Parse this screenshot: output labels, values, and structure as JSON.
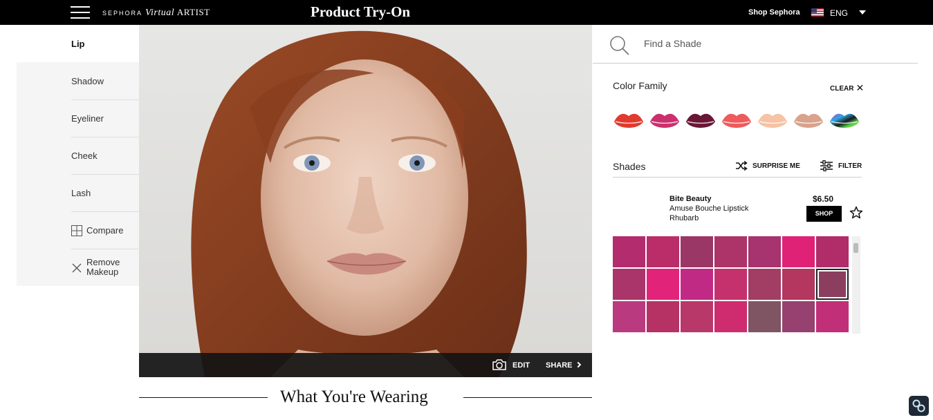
{
  "header": {
    "brand_sephora": "SEPHORA",
    "brand_virtual": "Virtual",
    "brand_artist": "ARTIST",
    "title": "Product Try-On",
    "shop_link": "Shop Sephora",
    "language": "ENG"
  },
  "sidebar": {
    "items": [
      {
        "label": "Lip"
      },
      {
        "label": "Shadow"
      },
      {
        "label": "Eyeliner"
      },
      {
        "label": "Cheek"
      },
      {
        "label": "Lash"
      },
      {
        "label": "Compare"
      },
      {
        "label": "Remove Makeup"
      }
    ]
  },
  "photo": {
    "edit_label": "EDIT",
    "share_label": "SHARE"
  },
  "wearing": {
    "title": "What You're Wearing"
  },
  "search": {
    "placeholder": "Find a Shade"
  },
  "color_family": {
    "title": "Color Family",
    "clear_label": "CLEAR",
    "swatches": [
      "#e23a2e",
      "#cc2f6e",
      "#6a1635",
      "#ef5a5a",
      "#f6c3a3",
      "#d9a28c",
      "multicolor"
    ]
  },
  "shades": {
    "title": "Shades",
    "surprise_label": "SURPRISE ME",
    "filter_label": "FILTER"
  },
  "product": {
    "brand": "Bite Beauty",
    "name": "Amuse Bouche Lipstick",
    "shade": "Rhubarb",
    "price": "$6.50",
    "shop_label": "SHOP"
  },
  "swatch_grid": {
    "rows": [
      [
        "#b32c6e",
        "#ba2d68",
        "#9a3766",
        "#ad3468",
        "#a7336f",
        "#df2275",
        "#b02d6a"
      ],
      [
        "#a9356a",
        "#e2237a",
        "#c12a84",
        "#c5316d",
        "#a23e63",
        "#b3375f",
        "#8c3e5e"
      ],
      [
        "#ba3a80",
        "#b63264",
        "#b9386a",
        "#cf2c70",
        "#7f5563",
        "#96416f",
        "#c12f78"
      ]
    ],
    "selected": "Rhubarb"
  }
}
